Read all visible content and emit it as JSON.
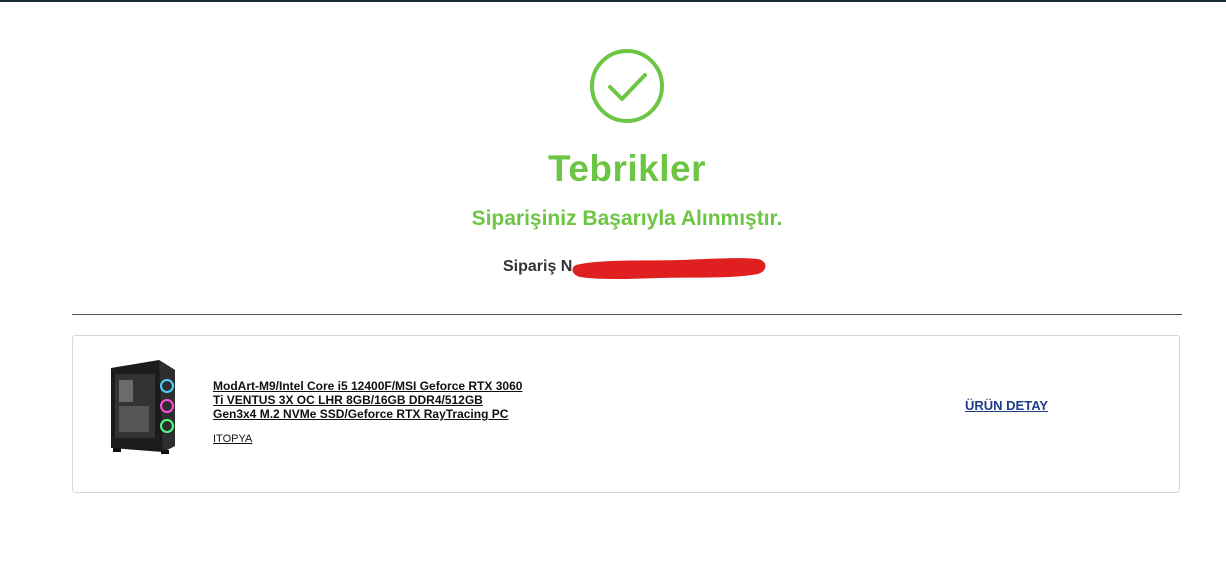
{
  "header": {
    "success_icon": "check-circle-icon",
    "title": "Tebrikler",
    "subtitle": "Siparişiniz Başarıyla Alınmıştır.",
    "order_label": "Sipariş N"
  },
  "colors": {
    "success": "#6cc644",
    "link": "#1f3c88",
    "redaction": "#e02020",
    "topbar": "#1a2e35"
  },
  "product": {
    "image_icon": "pc-case-image",
    "name": "ModArt-M9/Intel Core i5 12400F/MSI Geforce RTX 3060 Ti VENTUS 3X OC LHR 8GB/16GB DDR4/512GB Gen3x4 M.2 NVMe SSD/Geforce RTX RayTracing PC",
    "seller": "ITOPYA",
    "detail_label": "ÜRÜN DETAY"
  }
}
